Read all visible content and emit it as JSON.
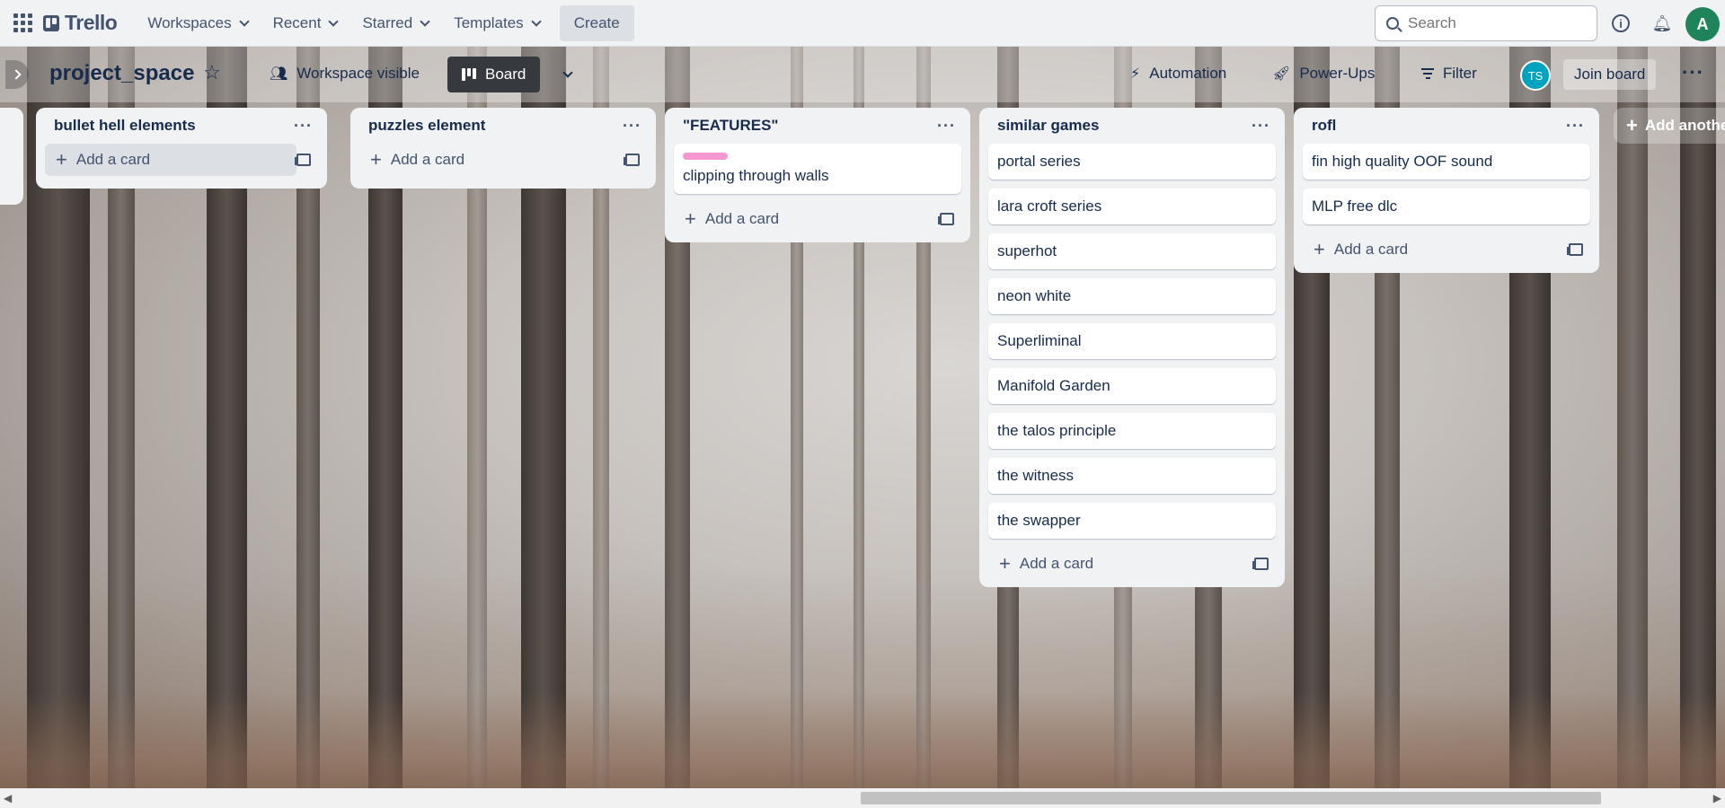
{
  "header": {
    "logo_text": "Trello",
    "nav": [
      "Workspaces",
      "Recent",
      "Starred",
      "Templates"
    ],
    "create_label": "Create",
    "search_placeholder": "Search",
    "avatar_initial": "A"
  },
  "board": {
    "title": "project_space",
    "visibility_label": "Workspace visible",
    "view_label": "Board",
    "automation_label": "Automation",
    "powerups_label": "Power-Ups",
    "filter_label": "Filter",
    "member_initials": "TS",
    "join_label": "Join board"
  },
  "lists": [
    {
      "title": "bullet hell elements",
      "cards": [],
      "add_label": "Add a card"
    },
    {
      "title": "puzzles element",
      "cards": [],
      "add_label": "Add a card"
    },
    {
      "title": "\"FEATURES\"",
      "cards": [
        {
          "text": "clipping through walls",
          "label_color": "#f797d2"
        }
      ],
      "add_label": "Add a card"
    },
    {
      "title": "similar games",
      "cards": [
        {
          "text": "portal series"
        },
        {
          "text": "lara croft series"
        },
        {
          "text": "superhot"
        },
        {
          "text": "neon white"
        },
        {
          "text": "Superliminal"
        },
        {
          "text": "Manifold Garden"
        },
        {
          "text": "the talos principle"
        },
        {
          "text": "the witness"
        },
        {
          "text": "the swapper"
        }
      ],
      "add_label": "Add a card"
    },
    {
      "title": "rofl",
      "cards": [
        {
          "text": "fin high quality OOF sound"
        },
        {
          "text": "MLP free dlc"
        }
      ],
      "add_label": "Add a card"
    }
  ],
  "add_another_label": "Add another list",
  "colors": {
    "header_bg": "#f1f2f4",
    "list_bg": "#f1f2f4",
    "avatar_a": "#1f845a",
    "avatar_ts": "#00a3bf",
    "label_pink": "#f797d2"
  }
}
